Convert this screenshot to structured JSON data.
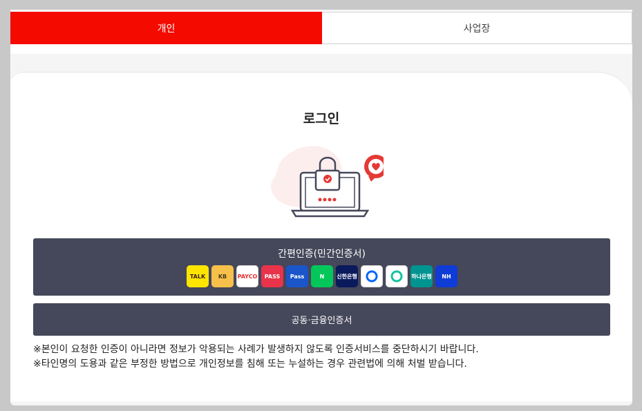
{
  "tabs": {
    "personal": "개인",
    "business": "사업장"
  },
  "login": {
    "title": "로그인"
  },
  "simple_auth": {
    "label": "간편인증(민간인증서)",
    "providers": [
      {
        "icon": "kakaotalk-icon",
        "text": "TALK",
        "bg": "#fee500",
        "fg": "#3c1e1e"
      },
      {
        "icon": "kb-bank-icon",
        "text": "KB",
        "bg": "#f7c04a",
        "fg": "#4b3a1b"
      },
      {
        "icon": "payco-icon",
        "text": "PAYCO",
        "bg": "#ffffff",
        "fg": "#e8312f"
      },
      {
        "icon": "pass-icon",
        "text": "PASS",
        "bg": "#e8334a",
        "fg": "#ffffff"
      },
      {
        "icon": "samsung-pass-icon",
        "text": "Pass",
        "bg": "#1a56c9",
        "fg": "#ffffff"
      },
      {
        "icon": "naver-icon",
        "text": "N",
        "bg": "#03c75a",
        "fg": "#ffffff"
      },
      {
        "icon": "shinhan-bank-icon",
        "text": "신한은행",
        "bg": "#0b1a5c",
        "fg": "#ffffff"
      },
      {
        "icon": "toss-icon",
        "text": "",
        "bg": "#ffffff",
        "fg": "#0064ff"
      },
      {
        "icon": "banksalad-icon",
        "text": "",
        "bg": "#ffffff",
        "fg": "#13c39c"
      },
      {
        "icon": "hana-bank-icon",
        "text": "하나은행",
        "bg": "#009490",
        "fg": "#ffffff"
      },
      {
        "icon": "nh-bank-icon",
        "text": "NH",
        "bg": "#0f3bd7",
        "fg": "#ffffff"
      }
    ]
  },
  "cert_auth": {
    "label": "공동·금융인증서"
  },
  "notices": [
    "※본인이 요청한 인증이 아니라면 정보가 악용되는 사례가 발생하지 않도록 인증서비스를 중단하시기 바랍니다.",
    "※타인명의 도용과 같은 부정한 방법으로 개인정보를 침해 또는 누설하는 경우 관련법에 의해 처벌 받습니다."
  ],
  "colors": {
    "accent": "#f50a00",
    "button": "#45475a"
  }
}
